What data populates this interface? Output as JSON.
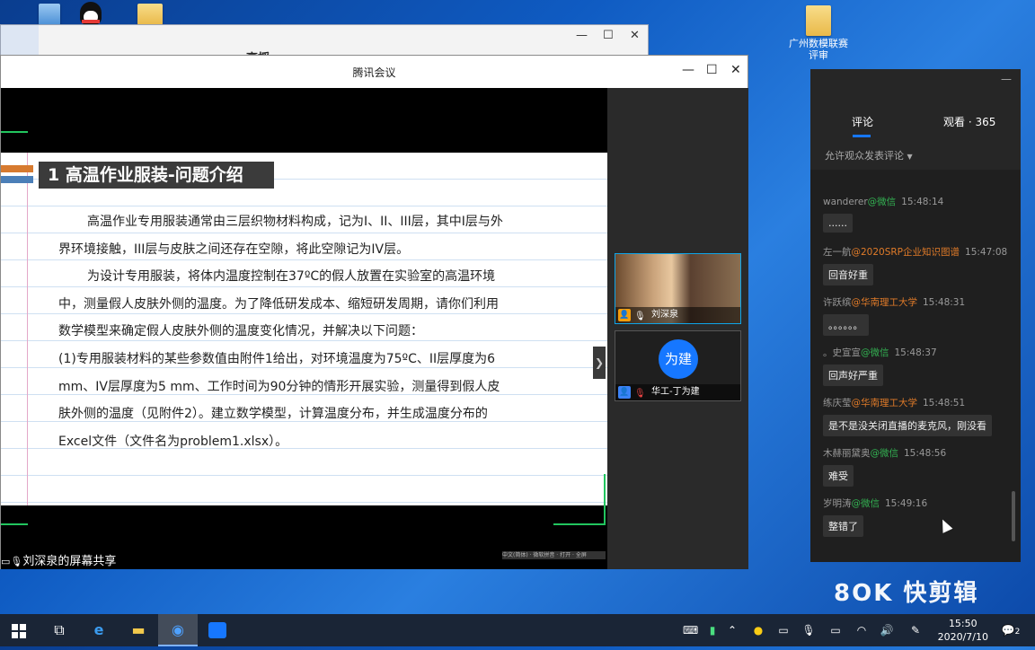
{
  "desktop": {
    "icon_folder_label": "广州数模联赛评审"
  },
  "bg_window": {
    "title_partial": "高揺",
    "controls": [
      "—",
      "☐",
      "✕"
    ]
  },
  "window": {
    "title": "腾讯会议",
    "controls": [
      "—",
      "☐",
      "✕"
    ]
  },
  "slide": {
    "heading": "1 高温作业服装-问题介绍",
    "paragraphs": [
      "高温作业专用服装通常由三层织物材料构成，记为I、II、III层，其中I层与外界环境接触，III层与皮肤之间还存在空隙，将此空隙记为IV层。",
      "为设计专用服装，将体内温度控制在37ºC的假人放置在实验室的高温环境中，测量假人皮肤外侧的温度。为了降低研发成本、缩短研发周期，请你们利用数学模型来确定假人皮肤外侧的温度变化情况，并解决以下问题：",
      "(1)专用服装材料的某些参数值由附件1给出，对环境温度为75ºC、II层厚度为6 mm、IV层厚度为5 mm、工作时间为90分钟的情形开展实验，测量得到假人皮肤外侧的温度（见附件2）。建立数学模型，计算温度分布，并生成温度分布的Excel文件（文件名为problem1.xlsx）。"
    ],
    "mini_status": "中文(简体) · 微软拼音 · 打开 · 全屏"
  },
  "share_label": "刘深泉的屏幕共享",
  "participants": [
    {
      "name": "刘深泉",
      "type": "video"
    },
    {
      "name": "华工-丁为建",
      "avatar_text": "为建",
      "type": "avatar"
    }
  ],
  "comments_panel": {
    "tab_comments": "评论",
    "tab_viewers": "观看 · 365",
    "allow_text": "允许观众发表评论",
    "comments": [
      {
        "user": "wanderer",
        "source": "@微信",
        "source_type": "wx",
        "time": "15:48:14",
        "text": "......"
      },
      {
        "user": "左一航",
        "source": "@2020SRP企业知识图谱",
        "source_type": "org",
        "time": "15:47:08",
        "text": "回音好重"
      },
      {
        "user": "许跃缤",
        "source": "@华南理工大学",
        "source_type": "org",
        "time": "15:48:31",
        "text": "。。。。。。"
      },
      {
        "user": "。史宣宣",
        "source": "@微信",
        "source_type": "wx",
        "time": "15:48:37",
        "text": "回声好严重"
      },
      {
        "user": "练庆莹",
        "source": "@华南理工大学",
        "source_type": "org",
        "time": "15:48:51",
        "text": "是不是没关闭直播的麦克风，刚没看"
      },
      {
        "user": "木赫丽黛奥",
        "source": "@微信",
        "source_type": "wx",
        "time": "15:48:56",
        "text": "难受"
      },
      {
        "user": "岁明涛",
        "source": "@微信",
        "source_type": "wx",
        "time": "15:49:16",
        "text": "整错了"
      }
    ]
  },
  "watermark": "8OK 快剪辑",
  "taskbar": {
    "time": "15:50",
    "date": "2020/7/10",
    "notification_count": "2"
  },
  "colors": {
    "accent_blue": "#1677ff",
    "orange_source": "#e07b29",
    "green_wechat": "#33b152"
  }
}
